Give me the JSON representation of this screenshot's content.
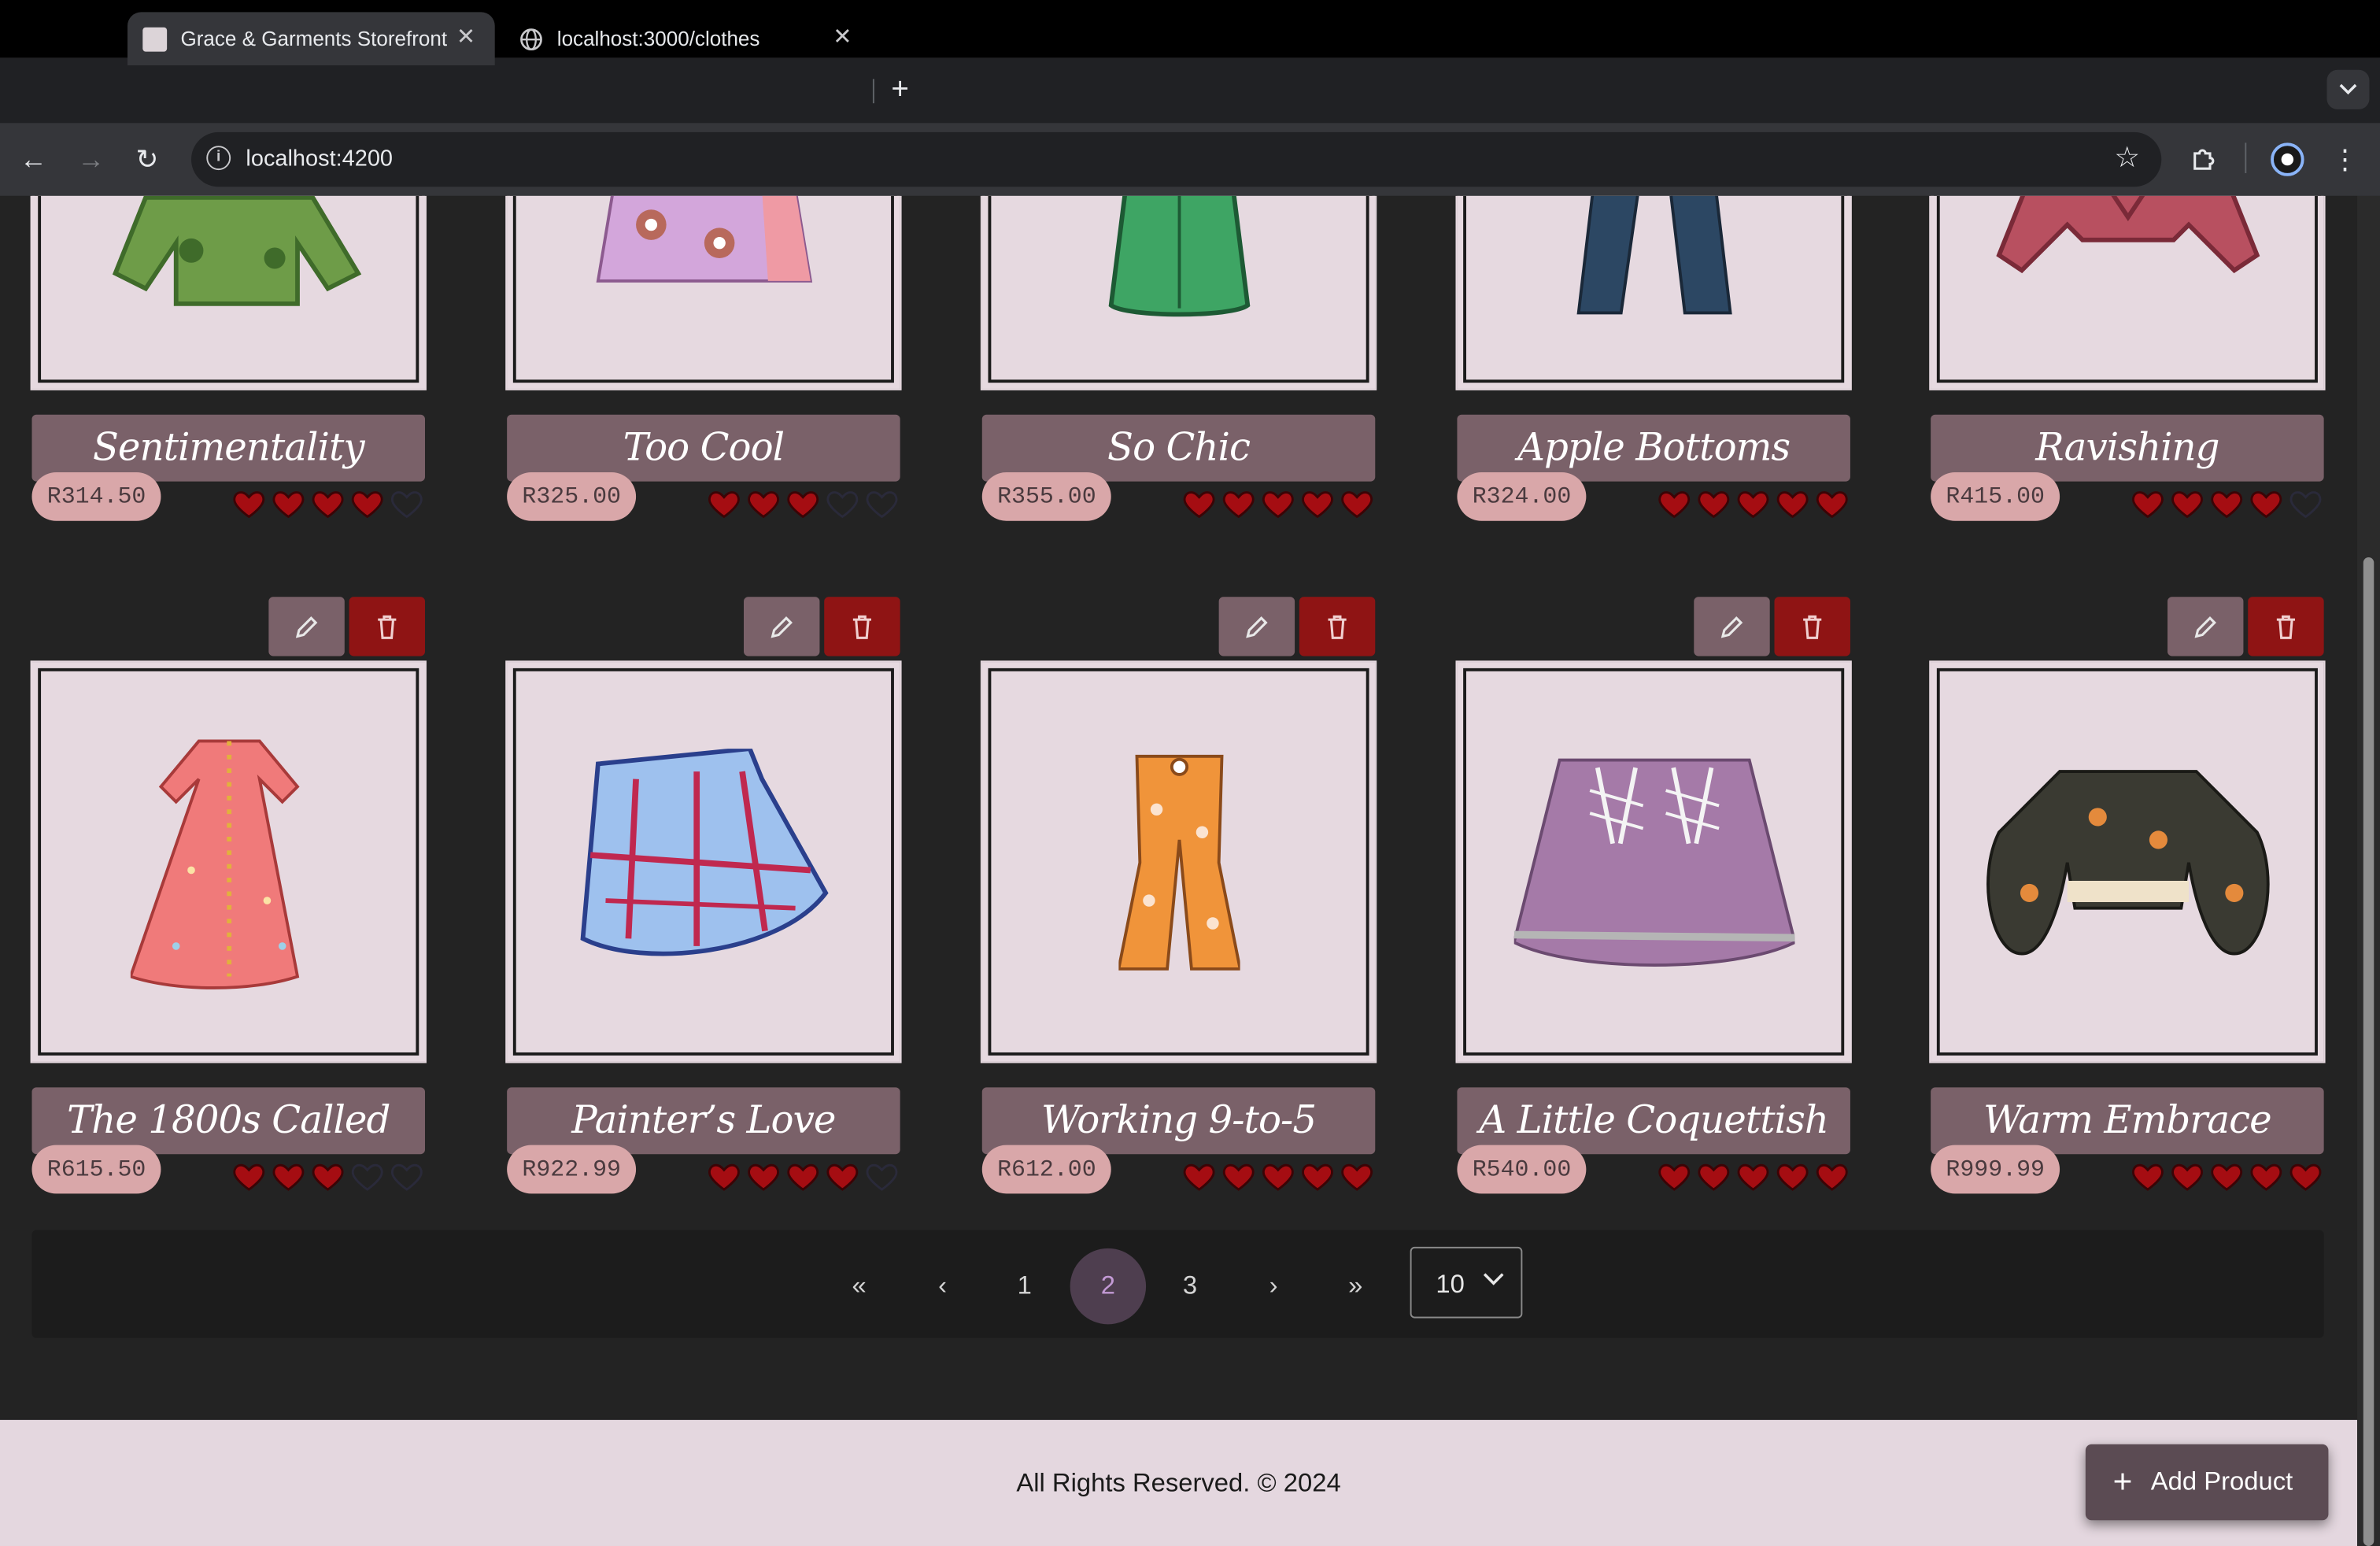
{
  "browser": {
    "tabs": [
      {
        "title": "Grace & Garments Storefront",
        "active": true
      },
      {
        "title": "localhost:3000/clothes",
        "active": false
      }
    ],
    "url": "localhost:4200"
  },
  "products_top_row": [
    {
      "name": "Sentimentality",
      "price": "R314.50",
      "rating": 4
    },
    {
      "name": "Too Cool",
      "price": "R325.00",
      "rating": 3
    },
    {
      "name": "So Chic",
      "price": "R355.00",
      "rating": 5
    },
    {
      "name": "Apple Bottoms",
      "price": "R324.00",
      "rating": 5
    },
    {
      "name": "Ravishing",
      "price": "R415.00",
      "rating": 4
    }
  ],
  "products_bottom_row": [
    {
      "name": "The 1800s Called",
      "price": "R615.50",
      "rating": 3,
      "image": "dress"
    },
    {
      "name": "Painter’s Love",
      "price": "R922.99",
      "rating": 4,
      "image": "skirt-plaid"
    },
    {
      "name": "Working 9-to-5",
      "price": "R612.00",
      "rating": 5,
      "image": "flare-pants"
    },
    {
      "name": "A Little Coquettish",
      "price": "R540.00",
      "rating": 5,
      "image": "skirt-lace"
    },
    {
      "name": "Warm Embrace",
      "price": "R999.99",
      "rating": 5,
      "image": "sweater"
    }
  ],
  "rating_max": 5,
  "pagination": {
    "first": "«",
    "prev": "‹",
    "pages": [
      "1",
      "2",
      "3"
    ],
    "current": "2",
    "next": "›",
    "last": "»",
    "page_size": "10"
  },
  "footer": {
    "copyright": "All Rights Reserved. © 2024",
    "add_button": "Add Product"
  },
  "colors": {
    "heart_filled": "#a50d12",
    "delete": "#8f1414",
    "card_bg": "#e6d9e0",
    "name_bar": "#7a6169",
    "price_pill": "#d9a7a9"
  }
}
